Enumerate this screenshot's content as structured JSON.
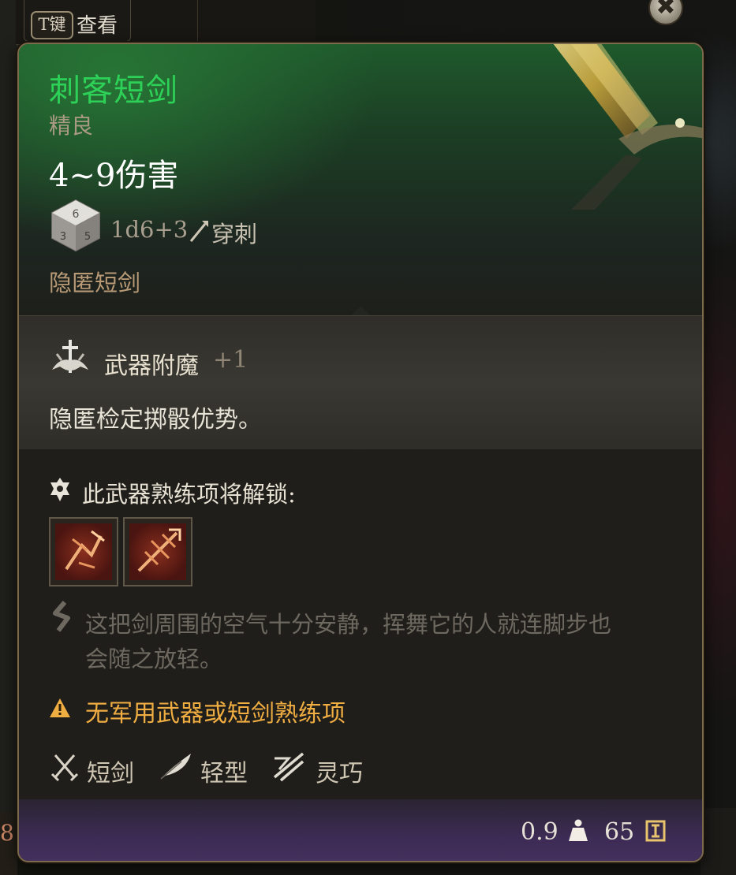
{
  "hotkey_bar": {
    "key": "T键",
    "label": "查看",
    "close_icon": "close-icon",
    "left_edge_number": "8"
  },
  "item": {
    "name": "刺客短剑",
    "rarity": "精良",
    "damage": "4~9伤害",
    "dice_formula": "1d6+3",
    "damage_type": "穿刺",
    "stealth_tag": "隐匿短剑",
    "name_color": "#2ed158",
    "rarity_color": "#a89a82"
  },
  "enchantment": {
    "name": "武器附魔",
    "bonus": "+1",
    "description": "隐匿检定掷骰优势。"
  },
  "proficiency": {
    "text": "此武器熟练项将解锁:",
    "actions": [
      {
        "icon": "weapon-action-icon-1"
      },
      {
        "icon": "weapon-action-icon-2"
      }
    ]
  },
  "flavor_lines": [
    "这把剑周围的空气十分安静，挥舞它的人就连脚步也",
    "会随之放轻。"
  ],
  "warning": {
    "text": "无军用武器或短剑熟练项",
    "color": "#f0ad42"
  },
  "traits": [
    {
      "label": "短剑",
      "icon": "shortsword-icon"
    },
    {
      "label": "轻型",
      "icon": "feather-icon"
    },
    {
      "label": "灵巧",
      "icon": "finesse-icon"
    }
  ],
  "footer": {
    "weight": "0.9",
    "price": "65"
  }
}
